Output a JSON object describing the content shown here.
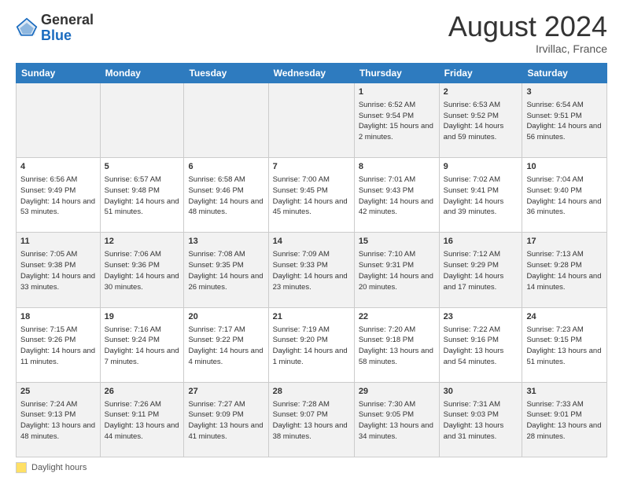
{
  "header": {
    "logo_general": "General",
    "logo_blue": "Blue",
    "month_title": "August 2024",
    "location": "Irvillac, France"
  },
  "footer": {
    "legend_label": "Daylight hours"
  },
  "calendar": {
    "days_of_week": [
      "Sunday",
      "Monday",
      "Tuesday",
      "Wednesday",
      "Thursday",
      "Friday",
      "Saturday"
    ],
    "weeks": [
      [
        {
          "day": "",
          "info": ""
        },
        {
          "day": "",
          "info": ""
        },
        {
          "day": "",
          "info": ""
        },
        {
          "day": "",
          "info": ""
        },
        {
          "day": "1",
          "info": "Sunrise: 6:52 AM\nSunset: 9:54 PM\nDaylight: 15 hours and 2 minutes."
        },
        {
          "day": "2",
          "info": "Sunrise: 6:53 AM\nSunset: 9:52 PM\nDaylight: 14 hours and 59 minutes."
        },
        {
          "day": "3",
          "info": "Sunrise: 6:54 AM\nSunset: 9:51 PM\nDaylight: 14 hours and 56 minutes."
        }
      ],
      [
        {
          "day": "4",
          "info": "Sunrise: 6:56 AM\nSunset: 9:49 PM\nDaylight: 14 hours and 53 minutes."
        },
        {
          "day": "5",
          "info": "Sunrise: 6:57 AM\nSunset: 9:48 PM\nDaylight: 14 hours and 51 minutes."
        },
        {
          "day": "6",
          "info": "Sunrise: 6:58 AM\nSunset: 9:46 PM\nDaylight: 14 hours and 48 minutes."
        },
        {
          "day": "7",
          "info": "Sunrise: 7:00 AM\nSunset: 9:45 PM\nDaylight: 14 hours and 45 minutes."
        },
        {
          "day": "8",
          "info": "Sunrise: 7:01 AM\nSunset: 9:43 PM\nDaylight: 14 hours and 42 minutes."
        },
        {
          "day": "9",
          "info": "Sunrise: 7:02 AM\nSunset: 9:41 PM\nDaylight: 14 hours and 39 minutes."
        },
        {
          "day": "10",
          "info": "Sunrise: 7:04 AM\nSunset: 9:40 PM\nDaylight: 14 hours and 36 minutes."
        }
      ],
      [
        {
          "day": "11",
          "info": "Sunrise: 7:05 AM\nSunset: 9:38 PM\nDaylight: 14 hours and 33 minutes."
        },
        {
          "day": "12",
          "info": "Sunrise: 7:06 AM\nSunset: 9:36 PM\nDaylight: 14 hours and 30 minutes."
        },
        {
          "day": "13",
          "info": "Sunrise: 7:08 AM\nSunset: 9:35 PM\nDaylight: 14 hours and 26 minutes."
        },
        {
          "day": "14",
          "info": "Sunrise: 7:09 AM\nSunset: 9:33 PM\nDaylight: 14 hours and 23 minutes."
        },
        {
          "day": "15",
          "info": "Sunrise: 7:10 AM\nSunset: 9:31 PM\nDaylight: 14 hours and 20 minutes."
        },
        {
          "day": "16",
          "info": "Sunrise: 7:12 AM\nSunset: 9:29 PM\nDaylight: 14 hours and 17 minutes."
        },
        {
          "day": "17",
          "info": "Sunrise: 7:13 AM\nSunset: 9:28 PM\nDaylight: 14 hours and 14 minutes."
        }
      ],
      [
        {
          "day": "18",
          "info": "Sunrise: 7:15 AM\nSunset: 9:26 PM\nDaylight: 14 hours and 11 minutes."
        },
        {
          "day": "19",
          "info": "Sunrise: 7:16 AM\nSunset: 9:24 PM\nDaylight: 14 hours and 7 minutes."
        },
        {
          "day": "20",
          "info": "Sunrise: 7:17 AM\nSunset: 9:22 PM\nDaylight: 14 hours and 4 minutes."
        },
        {
          "day": "21",
          "info": "Sunrise: 7:19 AM\nSunset: 9:20 PM\nDaylight: 14 hours and 1 minute."
        },
        {
          "day": "22",
          "info": "Sunrise: 7:20 AM\nSunset: 9:18 PM\nDaylight: 13 hours and 58 minutes."
        },
        {
          "day": "23",
          "info": "Sunrise: 7:22 AM\nSunset: 9:16 PM\nDaylight: 13 hours and 54 minutes."
        },
        {
          "day": "24",
          "info": "Sunrise: 7:23 AM\nSunset: 9:15 PM\nDaylight: 13 hours and 51 minutes."
        }
      ],
      [
        {
          "day": "25",
          "info": "Sunrise: 7:24 AM\nSunset: 9:13 PM\nDaylight: 13 hours and 48 minutes."
        },
        {
          "day": "26",
          "info": "Sunrise: 7:26 AM\nSunset: 9:11 PM\nDaylight: 13 hours and 44 minutes."
        },
        {
          "day": "27",
          "info": "Sunrise: 7:27 AM\nSunset: 9:09 PM\nDaylight: 13 hours and 41 minutes."
        },
        {
          "day": "28",
          "info": "Sunrise: 7:28 AM\nSunset: 9:07 PM\nDaylight: 13 hours and 38 minutes."
        },
        {
          "day": "29",
          "info": "Sunrise: 7:30 AM\nSunset: 9:05 PM\nDaylight: 13 hours and 34 minutes."
        },
        {
          "day": "30",
          "info": "Sunrise: 7:31 AM\nSunset: 9:03 PM\nDaylight: 13 hours and 31 minutes."
        },
        {
          "day": "31",
          "info": "Sunrise: 7:33 AM\nSunset: 9:01 PM\nDaylight: 13 hours and 28 minutes."
        }
      ]
    ]
  }
}
